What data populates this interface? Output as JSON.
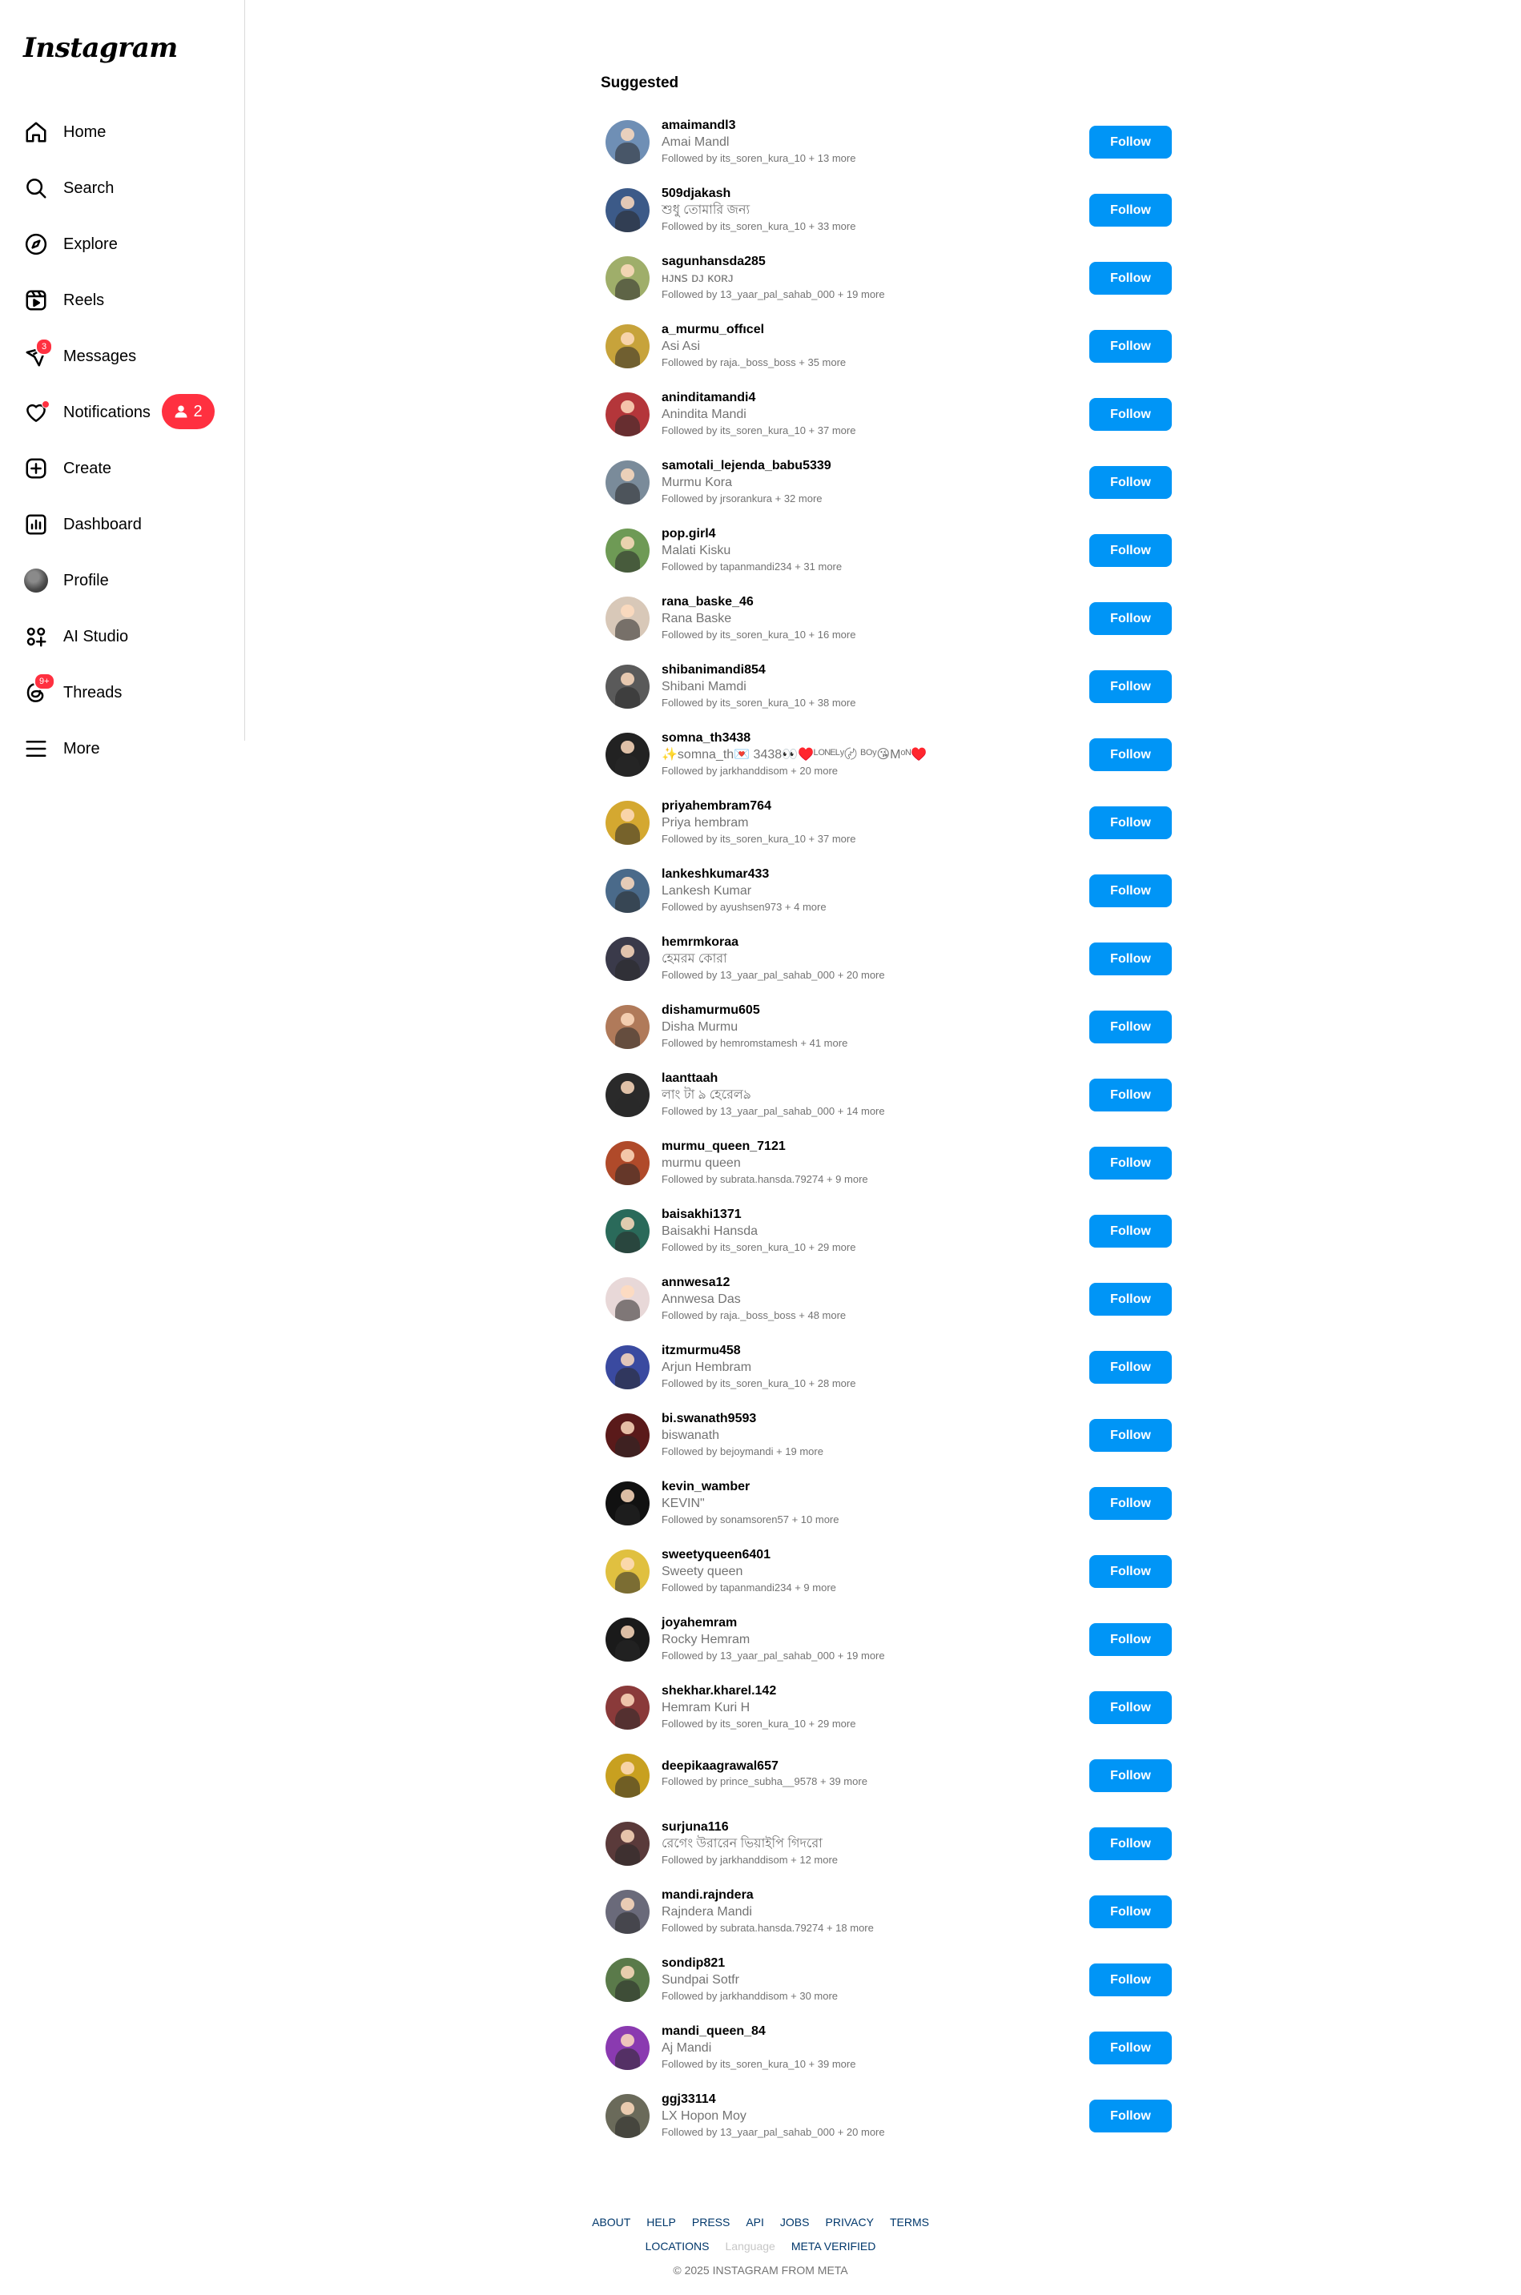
{
  "app": {
    "logo": "Instagram"
  },
  "sidebar": {
    "items": [
      {
        "label": "Home",
        "icon": "home-icon"
      },
      {
        "label": "Search",
        "icon": "search-icon"
      },
      {
        "label": "Explore",
        "icon": "compass-icon"
      },
      {
        "label": "Reels",
        "icon": "reels-icon"
      },
      {
        "label": "Messages",
        "icon": "messenger-icon",
        "badge": "3"
      },
      {
        "label": "Notifications",
        "icon": "heart-icon",
        "pill_count": "2"
      },
      {
        "label": "Create",
        "icon": "plus-square-icon"
      },
      {
        "label": "Dashboard",
        "icon": "dashboard-icon"
      },
      {
        "label": "Profile",
        "icon": "profile-avatar"
      },
      {
        "label": "AI Studio",
        "icon": "ai-studio-icon"
      },
      {
        "label": "Threads",
        "icon": "threads-icon",
        "badge": "9+"
      },
      {
        "label": "More",
        "icon": "menu-icon"
      }
    ]
  },
  "suggested": {
    "title": "Suggested",
    "follow_label": "Follow",
    "users": [
      {
        "username": "amaimandl3",
        "name": "Amai Mandl",
        "followed_by": "Followed by its_soren_kura_10 + 13 more",
        "color": "#6f8fb5"
      },
      {
        "username": "509djakash",
        "name": "শুধু তোমারি জন্য",
        "followed_by": "Followed by its_soren_kura_10 + 33 more",
        "color": "#3c5a88"
      },
      {
        "username": "sagunhansda285",
        "name": "ʜᴊɴꜱ ᴅᴊ ᴋᴏʀᴊ",
        "followed_by": "Followed by 13_yaar_pal_sahab_000 + 19 more",
        "color": "#9fae6a"
      },
      {
        "username": "a_murmu_offıcel",
        "name": "Asi Asi",
        "followed_by": "Followed by raja._boss_boss + 35 more",
        "color": "#c7a33b"
      },
      {
        "username": "aninditamandi4",
        "name": "Anindita Mandi",
        "followed_by": "Followed by its_soren_kura_10 + 37 more",
        "color": "#b4363a"
      },
      {
        "username": "samotali_lejenda_babu5339",
        "name": "Murmu Kora",
        "followed_by": "Followed by jrsorankura + 32 more",
        "color": "#7a8b9a"
      },
      {
        "username": "pop.girl4",
        "name": "Malati Kisku",
        "followed_by": "Followed by tapanmandi234 + 31 more",
        "color": "#6e9a55"
      },
      {
        "username": "rana_baske_46",
        "name": "Rana Baske",
        "followed_by": "Followed by its_soren_kura_10 + 16 more",
        "color": "#d8c8b8"
      },
      {
        "username": "shibanimandi854",
        "name": "Shibani Mamdi",
        "followed_by": "Followed by its_soren_kura_10 + 38 more",
        "color": "#5a5a5a"
      },
      {
        "username": "somna_th3438",
        "name": "✨somna_th💌 3438👀♥️ᴸᴼᴺᴱᴸʸ〄 ᴮᴼʸ😘Mᵒᴺ♥️",
        "followed_by": "Followed by jarkhanddisom + 20 more",
        "color": "#222222"
      },
      {
        "username": "priyahembram764",
        "name": "Priya hembram",
        "followed_by": "Followed by its_soren_kura_10 + 37 more",
        "color": "#d4a830"
      },
      {
        "username": "lankeshkumar433",
        "name": "Lankesh Kumar",
        "followed_by": "Followed by ayushsen973 + 4 more",
        "color": "#4a6a8a"
      },
      {
        "username": "hemrmkoraa",
        "name": "হেমরম কোরা",
        "followed_by": "Followed by 13_yaar_pal_sahab_000 + 20 more",
        "color": "#3a3a4a"
      },
      {
        "username": "dishamurmu605",
        "name": "Disha Murmu",
        "followed_by": "Followed by hemromstamesh + 41 more",
        "color": "#b07a5a"
      },
      {
        "username": "laanttaah",
        "name": "লাং টা ঌ হেরেলঌ",
        "followed_by": "Followed by 13_yaar_pal_sahab_000 + 14 more",
        "color": "#2a2a2a"
      },
      {
        "username": "murmu_queen_7121",
        "name": "murmu queen",
        "followed_by": "Followed by subrata.hansda.79274 + 9 more",
        "color": "#b04a2a"
      },
      {
        "username": "baisakhi1371",
        "name": "Baisakhi Hansda",
        "followed_by": "Followed by its_soren_kura_10 + 29 more",
        "color": "#2a6a5a"
      },
      {
        "username": "annwesa12",
        "name": "Annwesa Das",
        "followed_by": "Followed by raja._boss_boss + 48 more",
        "color": "#e8d8d8"
      },
      {
        "username": "itzmurmu458",
        "name": "Arjun Hembram",
        "followed_by": "Followed by its_soren_kura_10 + 28 more",
        "color": "#3a4aa0"
      },
      {
        "username": "bi.swanath9593",
        "name": "biswanath",
        "followed_by": "Followed by bejoymandi + 19 more",
        "color": "#5a1a1a"
      },
      {
        "username": "kevin_wamber",
        "name": "KEVIN\"",
        "followed_by": "Followed by sonamsoren57 + 10 more",
        "color": "#111111"
      },
      {
        "username": "sweetyqueen6401",
        "name": "Sweety queen",
        "followed_by": "Followed by tapanmandi234 + 9 more",
        "color": "#e0c040"
      },
      {
        "username": "joyahemram",
        "name": "Rocky Hemram",
        "followed_by": "Followed by 13_yaar_pal_sahab_000 + 19 more",
        "color": "#1a1a1a"
      },
      {
        "username": "shekhar.kharel.142",
        "name": "Hemram Kuri H",
        "followed_by": "Followed by its_soren_kura_10 + 29 more",
        "color": "#8a3a3a"
      },
      {
        "username": "deepikaagrawal657",
        "name": "",
        "followed_by": "Followed by prince_subha__9578 + 39 more",
        "color": "#c8a020"
      },
      {
        "username": "surjuna116",
        "name": "রেগেং উরারেন ভিয়াইপি গিদরো",
        "followed_by": "Followed by jarkhanddisom + 12 more",
        "color": "#5a3a3a"
      },
      {
        "username": "mandi.rajndera",
        "name": "Rajndera Mandi",
        "followed_by": "Followed by subrata.hansda.79274 + 18 more",
        "color": "#6a6a7a"
      },
      {
        "username": "sondip821",
        "name": "Sundpai Sotfr",
        "followed_by": "Followed by jarkhanddisom + 30 more",
        "color": "#5a7a4a"
      },
      {
        "username": "mandi_queen_84",
        "name": "Aj Mandi",
        "followed_by": "Followed by its_soren_kura_10 + 39 more",
        "color": "#8a3ab0"
      },
      {
        "username": "ggj33114",
        "name": "LX Hopon Moy",
        "followed_by": "Followed by 13_yaar_pal_sahab_000 + 20 more",
        "color": "#6a6a5a"
      }
    ]
  },
  "footer": {
    "links_row1": [
      "ABOUT",
      "HELP",
      "PRESS",
      "API",
      "JOBS",
      "PRIVACY",
      "TERMS"
    ],
    "links_row2": [
      "LOCATIONS",
      "Language",
      "META VERIFIED"
    ],
    "copyright": "© 2025 INSTAGRAM FROM META"
  }
}
